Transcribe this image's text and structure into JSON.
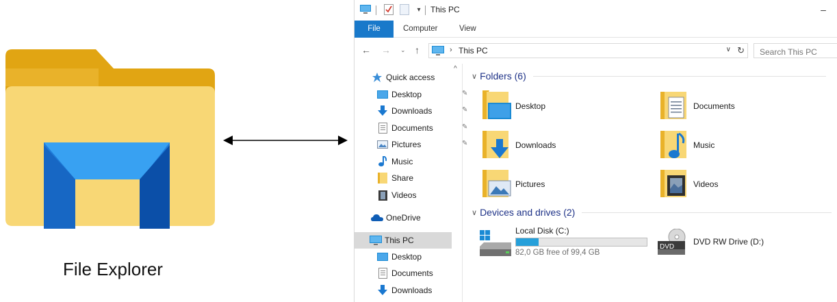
{
  "caption": "File Explorer",
  "window": {
    "title": "This PC",
    "minimize_glyph": "–"
  },
  "ribbon": {
    "tabs": [
      "File",
      "Computer",
      "View"
    ]
  },
  "address": {
    "path": "This PC",
    "search_placeholder": "Search This PC"
  },
  "nav": {
    "quick_access": "Quick access",
    "quick_items": [
      {
        "label": "Desktop",
        "icon": "desktop-icon",
        "pinned": true
      },
      {
        "label": "Downloads",
        "icon": "downloads-icon",
        "pinned": true
      },
      {
        "label": "Documents",
        "icon": "documents-icon",
        "pinned": true
      },
      {
        "label": "Pictures",
        "icon": "pictures-icon",
        "pinned": true
      },
      {
        "label": "Music",
        "icon": "music-icon",
        "pinned": false
      },
      {
        "label": "Share",
        "icon": "folder-icon",
        "pinned": false
      },
      {
        "label": "Videos",
        "icon": "videos-icon",
        "pinned": false
      }
    ],
    "onedrive": "OneDrive",
    "this_pc": "This PC",
    "this_pc_items": [
      {
        "label": "Desktop",
        "icon": "desktop-icon"
      },
      {
        "label": "Documents",
        "icon": "documents-icon"
      },
      {
        "label": "Downloads",
        "icon": "downloads-icon"
      }
    ]
  },
  "content": {
    "folders_header": "Folders (6)",
    "folders": [
      {
        "label": "Desktop",
        "icon": "desktop-folder-icon"
      },
      {
        "label": "Documents",
        "icon": "documents-folder-icon"
      },
      {
        "label": "Downloads",
        "icon": "downloads-folder-icon"
      },
      {
        "label": "Music",
        "icon": "music-folder-icon"
      },
      {
        "label": "Pictures",
        "icon": "pictures-folder-icon"
      },
      {
        "label": "Videos",
        "icon": "videos-folder-icon"
      }
    ],
    "drives_header": "Devices and drives (2)",
    "drives": [
      {
        "label": "Local Disk (C:)",
        "free_text": "82,0 GB free of 99,4 GB",
        "used_fraction": 0.175,
        "icon": "hard-drive-icon"
      },
      {
        "label": "DVD RW Drive (D:)",
        "icon": "dvd-drive-icon",
        "badge": "DVD"
      }
    ]
  },
  "colors": {
    "accent": "#1979ca",
    "folder_yellow": "#f8d775",
    "header_blue": "#1e3287",
    "progress": "#26a0da"
  }
}
